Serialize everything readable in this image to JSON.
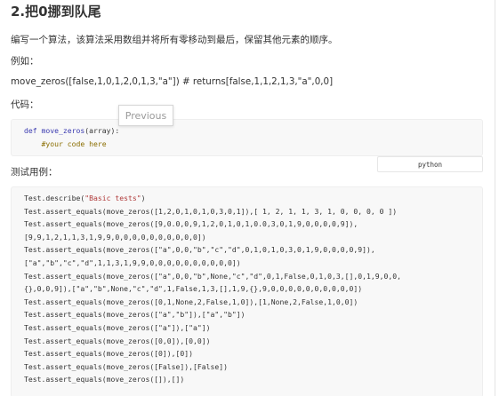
{
  "title": "2.把0挪到队尾",
  "description": "编写一个算法，该算法采用数组并将所有零移动到最后，保留其他元素的顺序。",
  "example_label": "例如：",
  "example_code": "move_zeros([false,1,0,1,2,0,1,3,\"a\"]) # returns[false,1,1,2,1,3,\"a\",0,0]",
  "code_label": "代码：",
  "tooltip_label": "Previous",
  "starter_code": {
    "kw": "def",
    "fn": "move_zeros",
    "params": "(array):",
    "comment": "#your code here"
  },
  "tests_label": "测试用例：",
  "language_label": "python",
  "tests": {
    "describe_prefix": "Test.describe(",
    "describe_string": "\"Basic tests\"",
    "describe_suffix": ")",
    "lines": [
      "Test.assert_equals(move_zeros([1,2,0,1,0,1,0,3,0,1]),[ 1, 2, 1, 1, 3, 1, 0, 0, 0, 0 ])",
      "Test.assert_equals(move_zeros([9,0.0,0,9,1,2,0,1,0,1,0.0,3,0,1,9,0,0,0,0,9]),",
      "[9,9,1,2,1,1,3,1,9,9,0,0,0,0,0,0,0,0,0,0])",
      "Test.assert_equals(move_zeros([\"a\",0,0,\"b\",\"c\",\"d\",0,1,0,1,0,3,0,1,9,0,0,0,0,9]),",
      "[\"a\",\"b\",\"c\",\"d\",1,1,3,1,9,9,0,0,0,0,0,0,0,0,0,0])",
      "Test.assert_equals(move_zeros([\"a\",0,0,\"b\",None,\"c\",\"d\",0,1,False,0,1,0,3,[],0,1,9,0,0,",
      "{},0,0,9]),[\"a\",\"b\",None,\"c\",\"d\",1,False,1,3,[],1,9,{},9,0,0,0,0,0,0,0,0,0,0])",
      "Test.assert_equals(move_zeros([0,1,None,2,False,1,0]),[1,None,2,False,1,0,0])",
      "Test.assert_equals(move_zeros([\"a\",\"b\"]),[\"a\",\"b\"])",
      "Test.assert_equals(move_zeros([\"a\"]),[\"a\"])",
      "Test.assert_equals(move_zeros([0,0]),[0,0])",
      "Test.assert_equals(move_zeros([0]),[0])",
      "Test.assert_equals(move_zeros([False]),[False])",
      "Test.assert_equals(move_zeros([]),[])"
    ]
  }
}
